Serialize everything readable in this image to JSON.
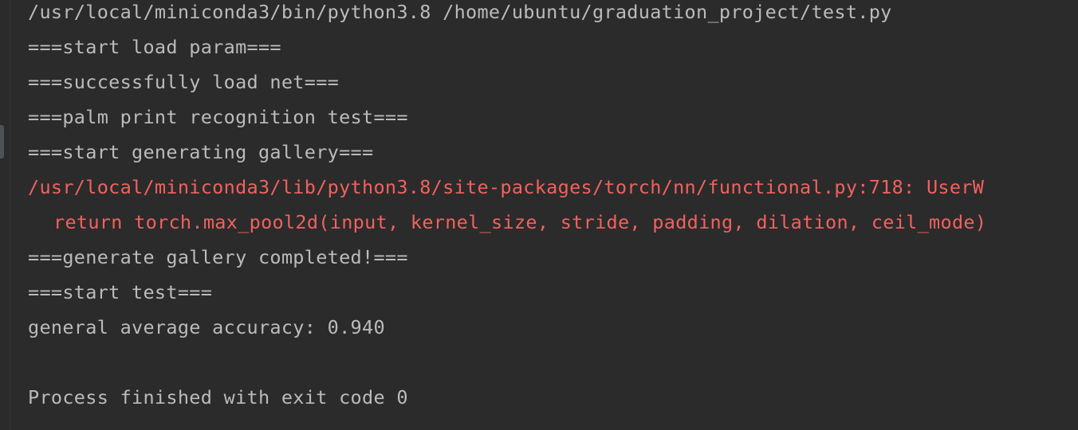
{
  "console": {
    "lines": {
      "command": "/usr/local/miniconda3/bin/python3.8 /home/ubuntu/graduation_project/test.py",
      "start_load_param": "===start load param===",
      "load_net": "===successfully load net===",
      "palm_test": "===palm print recognition test===",
      "start_gallery": "===start generating gallery===",
      "warning_path": "/usr/local/miniconda3/lib/python3.8/site-packages/torch/nn/functional.py:718: UserW",
      "warning_call": "return torch.max_pool2d(input, kernel_size, stride, padding, dilation, ceil_mode)",
      "gallery_done": "===generate gallery completed!===",
      "start_test": "===start test===",
      "accuracy": "general average accuracy: 0.940",
      "blank": "",
      "exit": "Process finished with exit code 0"
    }
  },
  "colors": {
    "background": "#2b2b2b",
    "text": "#bbbbbb",
    "error": "#f0625e"
  }
}
